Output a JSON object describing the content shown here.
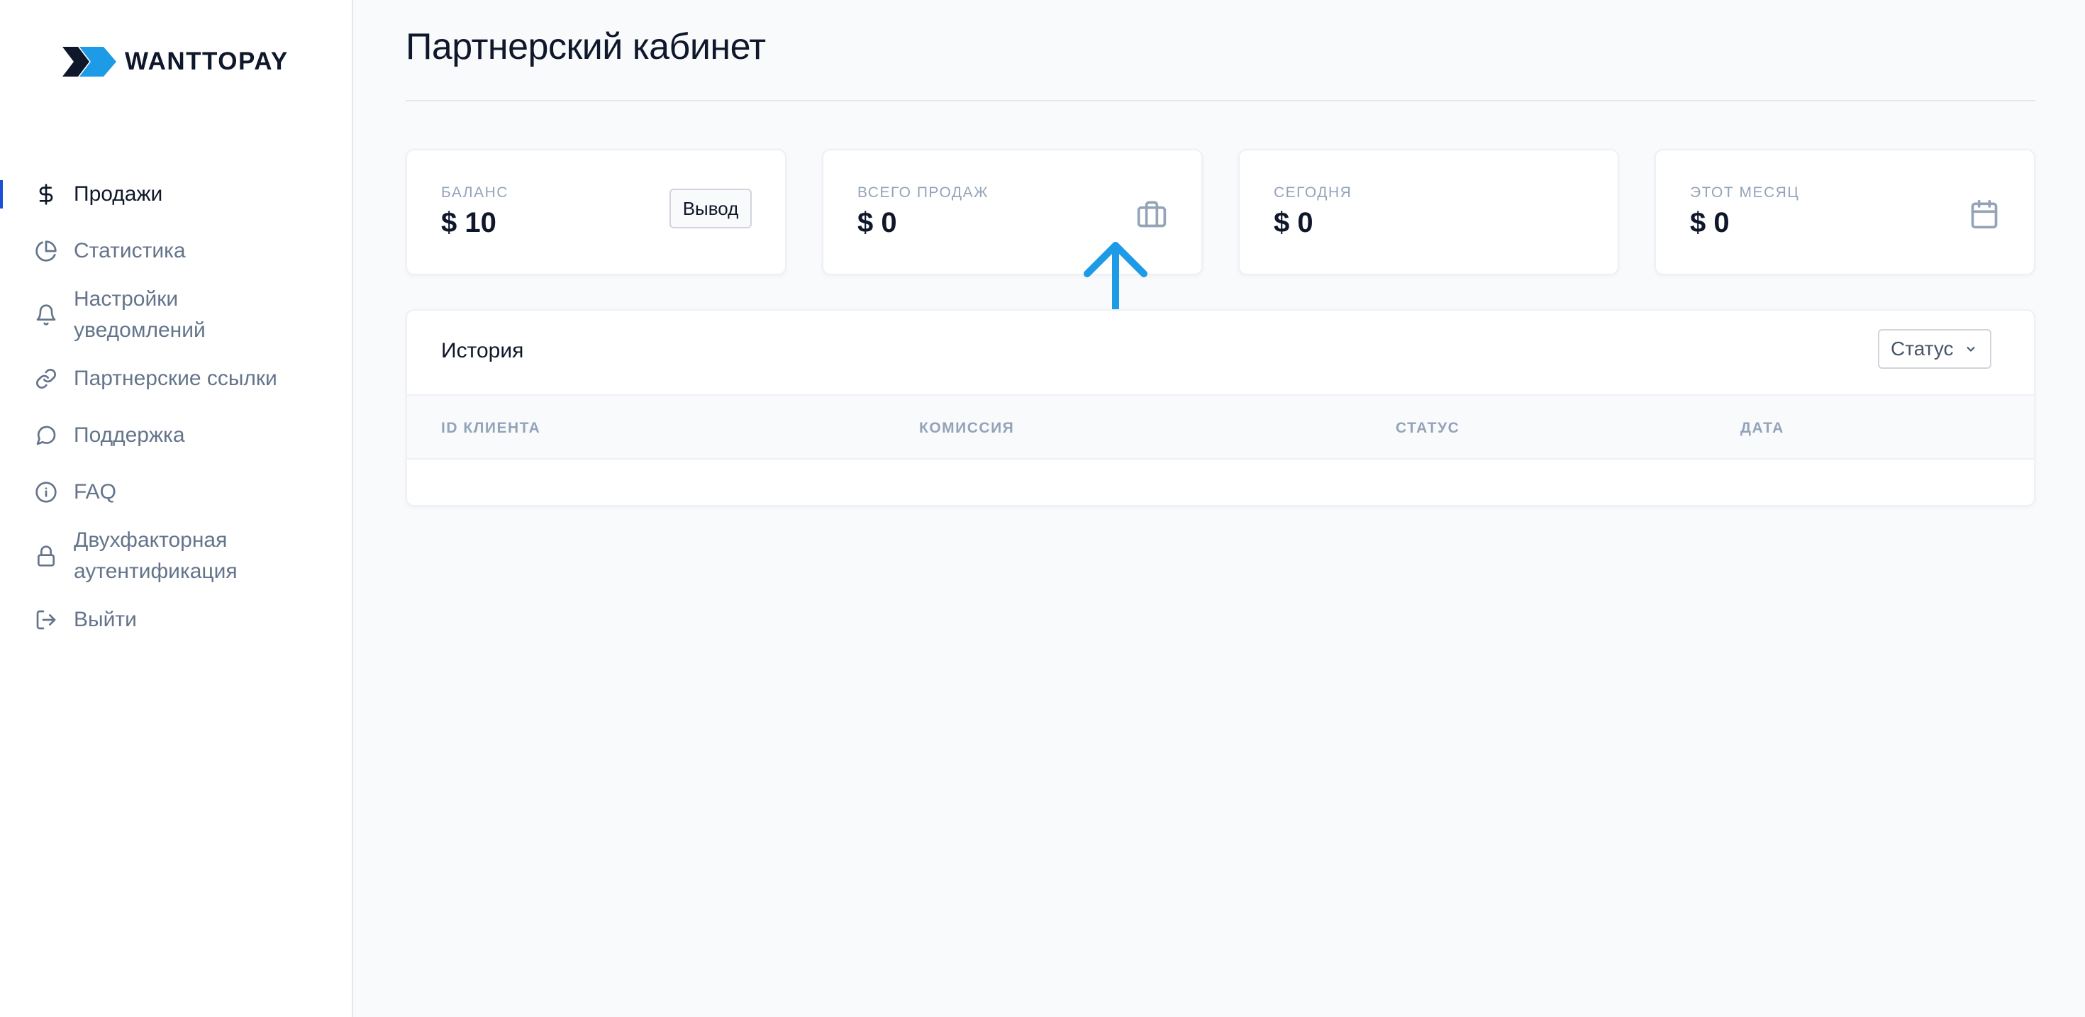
{
  "brand": {
    "name": "WANTTOPAY",
    "colors": {
      "dark": "#0f172a",
      "blue": "#1e9be6"
    }
  },
  "sidebar": {
    "items": [
      {
        "label": "Продажи",
        "icon": "dollar-icon",
        "active": true
      },
      {
        "label": "Статистика",
        "icon": "pie-chart-icon"
      },
      {
        "label": "Настройки уведомлений",
        "icon": "bell-icon"
      },
      {
        "label": "Партнерские ссылки",
        "icon": "link-icon"
      },
      {
        "label": "Поддержка",
        "icon": "chat-bubble-icon"
      },
      {
        "label": "FAQ",
        "icon": "info-icon"
      },
      {
        "label": "Двухфакторная аутентификация",
        "icon": "lock-icon"
      },
      {
        "label": "Выйти",
        "icon": "logout-icon"
      }
    ]
  },
  "page": {
    "title": "Партнерский кабинет"
  },
  "cards": [
    {
      "label": "Баланс",
      "value": "$ 10",
      "button_label": "Вывод"
    },
    {
      "label": "Всего продаж",
      "value": "$ 0",
      "icon": "briefcase-icon"
    },
    {
      "label": "Сегодня",
      "value": "$ 0"
    },
    {
      "label": "Этот месяц",
      "value": "$ 0",
      "icon": "calendar-icon"
    }
  ],
  "history": {
    "title": "История",
    "status_filter": {
      "value": "Статус"
    },
    "columns": [
      "ID клиента",
      "Комиссия",
      "Статус",
      "Дата"
    ],
    "rows": []
  },
  "annotation": {
    "color": "#1e9be6",
    "icon": "arrow-up-icon"
  }
}
